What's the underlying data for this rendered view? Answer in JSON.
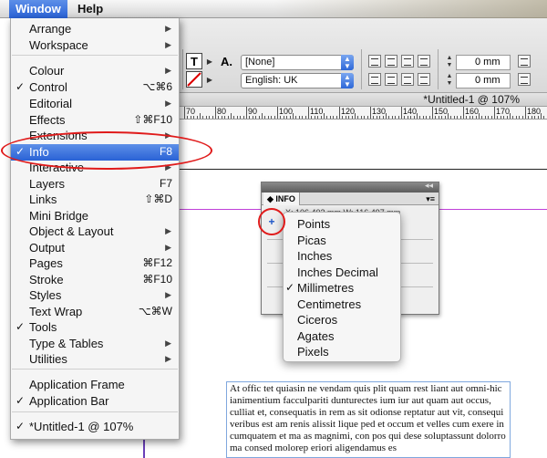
{
  "menubar": {
    "items": [
      "Window",
      "Help"
    ]
  },
  "window_menu": {
    "items": [
      {
        "label": "Arrange",
        "submenu": true
      },
      {
        "label": "Workspace",
        "submenu": true
      },
      {
        "label": "Colour",
        "submenu": true
      },
      {
        "label": "Control",
        "checked": true,
        "shortcut": "⌥⌘6"
      },
      {
        "label": "Editorial",
        "submenu": true
      },
      {
        "label": "Effects",
        "shortcut": "⇧⌘F10"
      },
      {
        "label": "Extensions",
        "submenu": true
      },
      {
        "label": "Info",
        "checked": true,
        "shortcut": "F8",
        "highlighted": true
      },
      {
        "label": "Interactive",
        "submenu": true
      },
      {
        "label": "Layers",
        "shortcut": "F7"
      },
      {
        "label": "Links",
        "shortcut": "⇧⌘D"
      },
      {
        "label": "Mini Bridge"
      },
      {
        "label": "Object & Layout",
        "submenu": true
      },
      {
        "label": "Output",
        "submenu": true
      },
      {
        "label": "Pages",
        "shortcut": "⌘F12"
      },
      {
        "label": "Stroke",
        "shortcut": "⌘F10"
      },
      {
        "label": "Styles",
        "submenu": true
      },
      {
        "label": "Text Wrap",
        "shortcut": "⌥⌘W"
      },
      {
        "label": "Tools",
        "checked": true
      },
      {
        "label": "Type & Tables",
        "submenu": true
      },
      {
        "label": "Utilities",
        "submenu": true
      },
      {
        "label": "Application Frame"
      },
      {
        "label": "Application Bar",
        "checked": true
      },
      {
        "label": "*Untitled-1 @ 107%",
        "checked": true
      }
    ]
  },
  "control_panel": {
    "font_style": "[None]",
    "language": "English: UK",
    "indent_1": "0 mm",
    "indent_2": "0 mm",
    "type_icon": "T",
    "char_icon": "A."
  },
  "document": {
    "title": "*Untitled-1 @ 107%",
    "ruler_labels": [
      "70",
      "80",
      "90",
      "100",
      "110",
      "120",
      "130",
      "140",
      "150",
      "160",
      "170",
      "180"
    ]
  },
  "info_panel": {
    "tab": "INFO",
    "readout": "X: 106.402 mm  W: 116.497 mm"
  },
  "units_menu": {
    "items": [
      {
        "label": "Points"
      },
      {
        "label": "Picas"
      },
      {
        "label": "Inches"
      },
      {
        "label": "Inches Decimal"
      },
      {
        "label": "Millimetres",
        "checked": true
      },
      {
        "label": "Centimetres"
      },
      {
        "label": "Ciceros"
      },
      {
        "label": "Agates"
      },
      {
        "label": "Pixels"
      }
    ]
  },
  "body_text": "At offic tet quiasin ne vendam quis plit quam rest liant aut omni-hic ianimentium facculpariti dunturectes ium iur aut quam aut occus, culliat et, consequatis in rem as sit odionse reptatur aut vit, consequi veribus est am renis alissit lique ped et occum et velles cum exere in cumquatem et ma as magnimi, con pos qui dese soluptassunt dolorro ma consed molorep eriori aligendamus es"
}
